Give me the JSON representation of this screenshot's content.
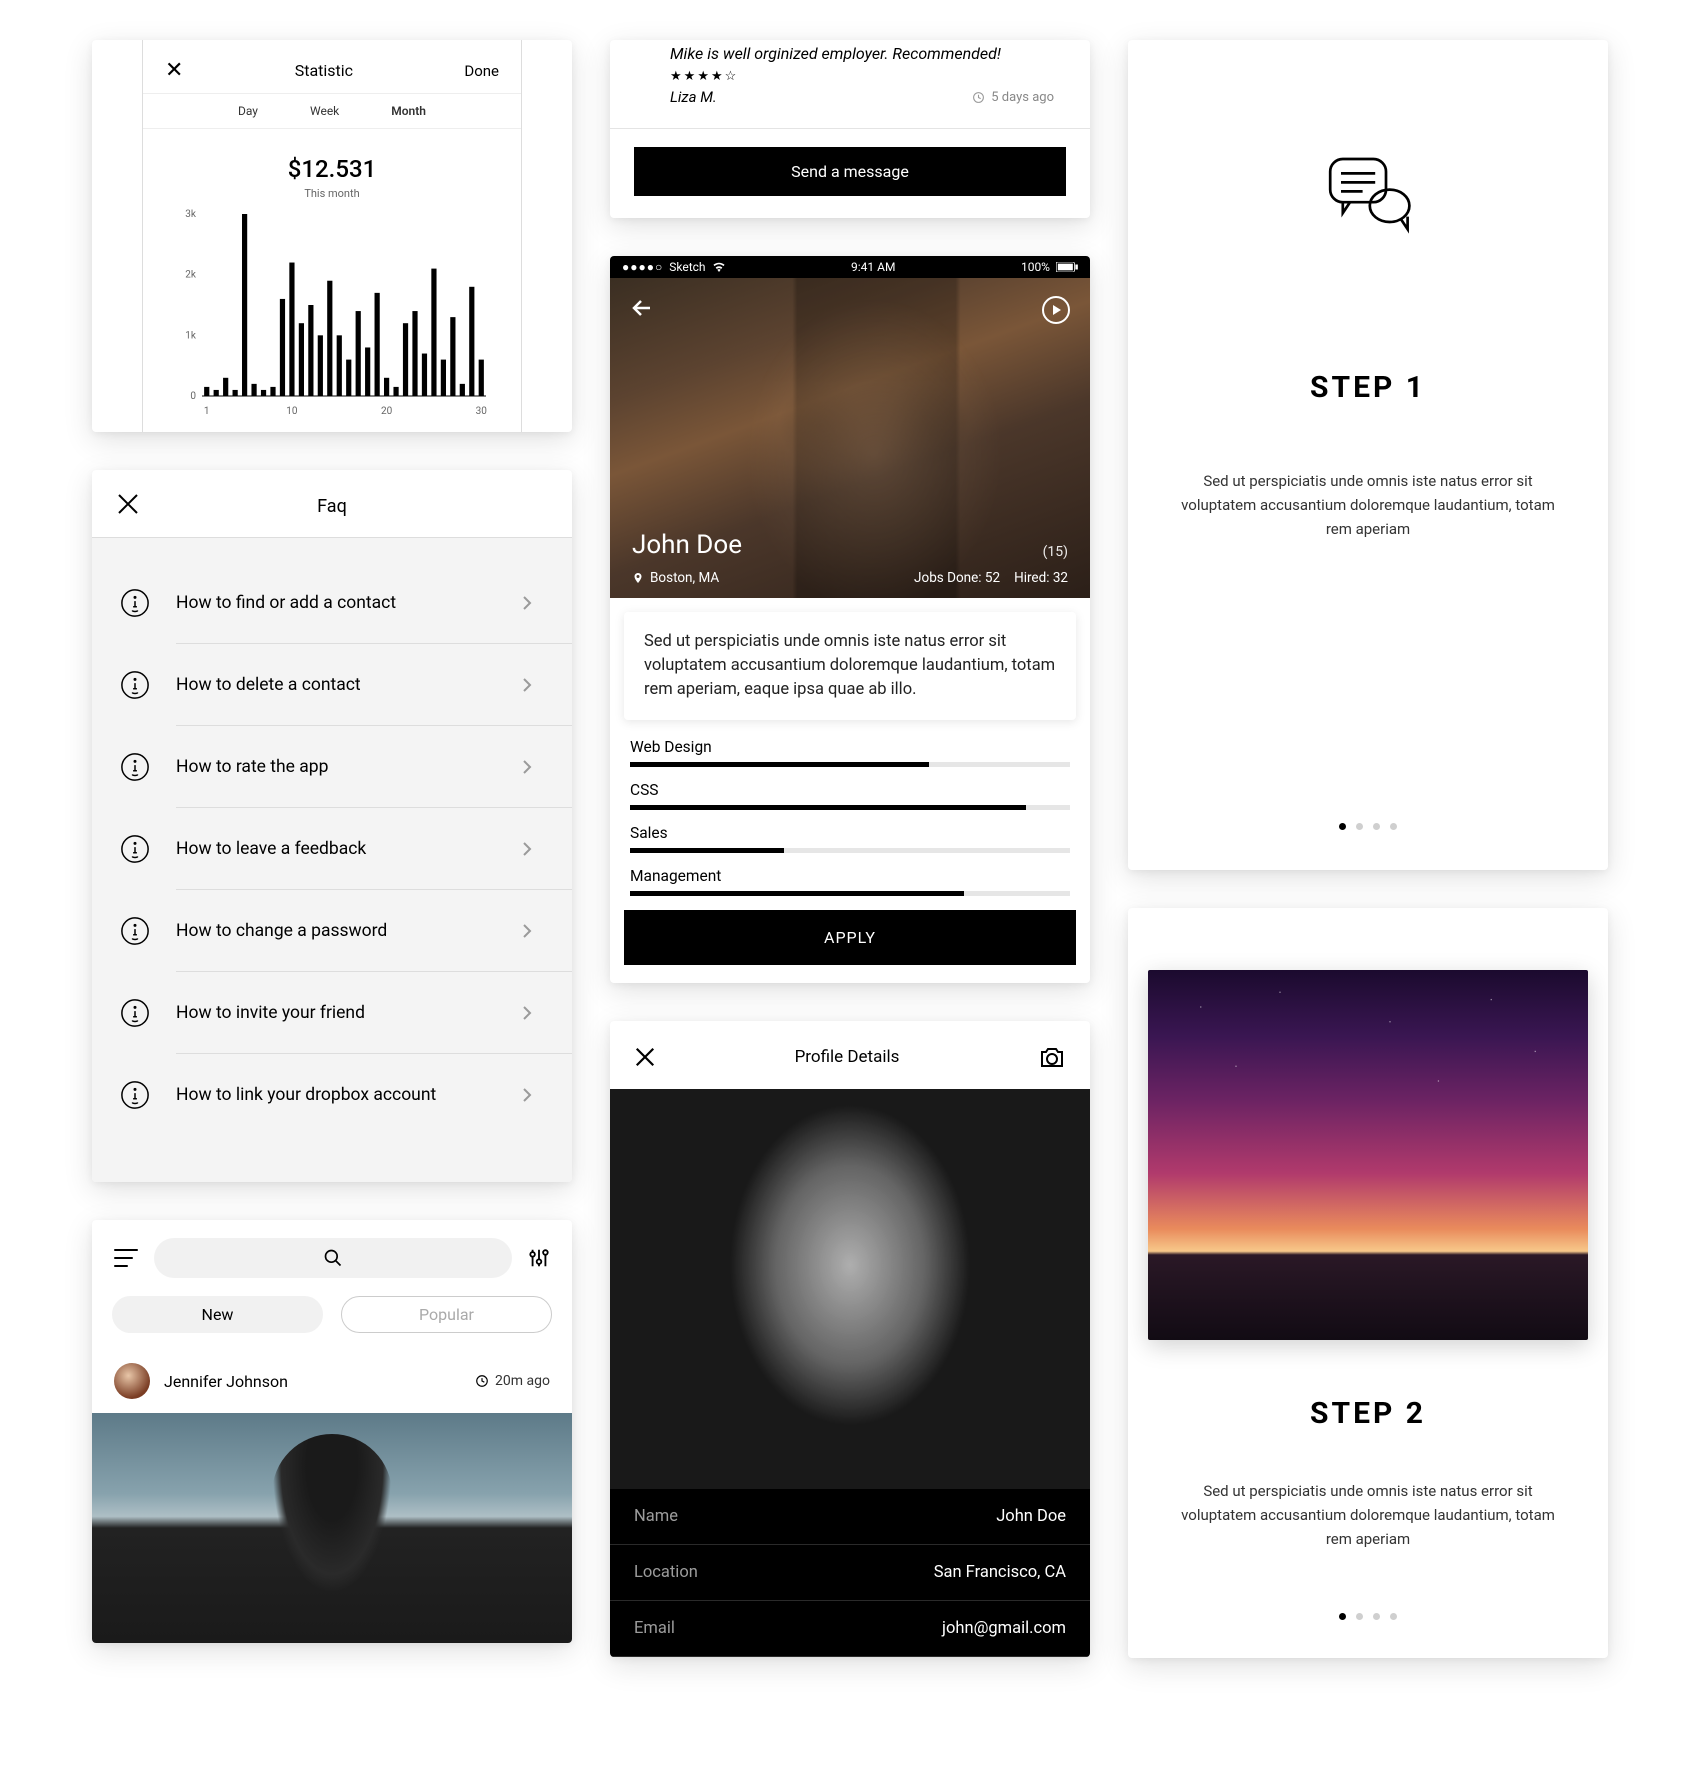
{
  "stat": {
    "title": "Statistic",
    "done": "Done",
    "tabs": [
      "Day",
      "Week",
      "Month"
    ],
    "amount": "$12.531",
    "amount_sub": "This month"
  },
  "chart_data": {
    "type": "bar",
    "title": "This month",
    "xlabel": "",
    "ylabel": "",
    "ylim": [
      0,
      3000
    ],
    "yticks": [
      "0",
      "1k",
      "2k",
      "3k"
    ],
    "xticks": [
      1,
      10,
      20,
      30
    ],
    "categories": [
      1,
      2,
      3,
      4,
      5,
      6,
      7,
      8,
      9,
      10,
      11,
      12,
      13,
      14,
      15,
      16,
      17,
      18,
      19,
      20,
      21,
      22,
      23,
      24,
      25,
      26,
      27,
      28,
      29,
      30
    ],
    "values": [
      150,
      100,
      300,
      100,
      3000,
      200,
      100,
      150,
      1600,
      2200,
      1200,
      1500,
      1000,
      1900,
      1000,
      600,
      1400,
      800,
      1700,
      300,
      150,
      1200,
      1400,
      700,
      2100,
      600,
      1300,
      200,
      1800,
      600
    ]
  },
  "faq": {
    "title": "Faq",
    "items": [
      "How to find or add a contact",
      "How to delete a contact",
      "How to rate the app",
      "How to leave a feedback",
      "How to change a password",
      "How to invite your friend",
      "How to link your dropbox account"
    ]
  },
  "feed": {
    "tabs": {
      "new": "New",
      "popular": "Popular"
    },
    "post": {
      "author": "Jennifer Johnson",
      "time": "20m ago"
    }
  },
  "review": {
    "text": "Mike is well orginized employer. Recommended!",
    "stars": 4,
    "author": "Liza M.",
    "time": "5 days ago",
    "cta": "Send a message"
  },
  "profile": {
    "status": {
      "carrier": "Sketch",
      "time": "9:41 AM",
      "battery": "100%"
    },
    "name": "John Doe",
    "count": "(15)",
    "location": "Boston, MA",
    "jobs_done": "Jobs Done: 52",
    "hired": "Hired: 32",
    "desc": "Sed ut perspiciatis unde omnis iste natus error sit voluptatem accusantium doloremque laudantium, totam rem aperiam, eaque ipsa quae ab illo.",
    "skills": [
      {
        "label": "Web Design",
        "pct": 68
      },
      {
        "label": "CSS",
        "pct": 90
      },
      {
        "label": "Sales",
        "pct": 35
      },
      {
        "label": "Management",
        "pct": 76
      }
    ],
    "apply": "APPLY"
  },
  "profile_details": {
    "title": "Profile Details",
    "rows": [
      {
        "label": "Name",
        "value": "John Doe"
      },
      {
        "label": "Location",
        "value": "San Francisco, CA"
      },
      {
        "label": "Email",
        "value": "john@gmail.com"
      }
    ]
  },
  "step1": {
    "title": "STEP 1",
    "desc": "Sed ut perspiciatis unde omnis iste natus error sit voluptatem accusantium doloremque laudantium, totam rem aperiam"
  },
  "step2": {
    "title": "STEP 2",
    "desc": "Sed ut perspiciatis unde omnis iste natus error sit voluptatem accusantium doloremque laudantium, totam rem aperiam"
  }
}
